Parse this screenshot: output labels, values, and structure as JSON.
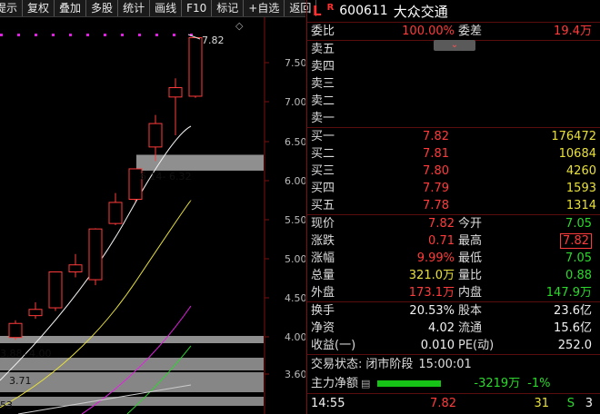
{
  "toolbar": {
    "items": [
      "提示",
      "复权",
      "叠加",
      "多股",
      "统计",
      "画线",
      "F10",
      "标记",
      "+自选",
      "返回"
    ]
  },
  "quote": {
    "lr_marker": "L",
    "r_marker": "R",
    "code": "600611",
    "name": "大众交通",
    "weibi_label": "委比",
    "weibi_value": "100.00%",
    "weicha_label": "委差",
    "weicha_value": "19.4万",
    "sell": [
      {
        "label": "卖五"
      },
      {
        "label": "卖四"
      },
      {
        "label": "卖三"
      },
      {
        "label": "卖二"
      },
      {
        "label": "卖一"
      }
    ],
    "buy": [
      {
        "label": "买一",
        "price": "7.82",
        "volume": "176472"
      },
      {
        "label": "买二",
        "price": "7.81",
        "volume": "10684"
      },
      {
        "label": "买三",
        "price": "7.80",
        "volume": "4260"
      },
      {
        "label": "买四",
        "price": "7.79",
        "volume": "1593"
      },
      {
        "label": "买五",
        "price": "7.78",
        "volume": "1314"
      }
    ],
    "stats": [
      {
        "l1": "现价",
        "v1": "7.82",
        "l2": "今开",
        "v2": "7.05"
      },
      {
        "l1": "涨跌",
        "v1": "0.71",
        "l2": "最高",
        "v2": "7.82"
      },
      {
        "l1": "涨幅",
        "v1": "9.99%",
        "l2": "最低",
        "v2": "7.05"
      },
      {
        "l1": "总量",
        "v1": "321.0万",
        "l2": "量比",
        "v2": "0.88"
      },
      {
        "l1": "外盘",
        "v1": "173.1万",
        "l2": "内盘",
        "v2": "147.9万"
      }
    ],
    "fund": [
      {
        "l1": "换手",
        "v1": "20.53%",
        "l2": "股本",
        "v2": "23.6亿"
      },
      {
        "l1": "净资",
        "v1": "4.02",
        "l2": "流通",
        "v2": "15.6亿"
      },
      {
        "l1": "收益(一)",
        "v1": "0.010",
        "l2": "PE(动)",
        "v2": "252.0"
      }
    ],
    "trade_status_label": "交易状态:",
    "trade_status_value": "闭市阶段",
    "trade_status_time": "15:00:01",
    "main_flow_label": "主力净额",
    "main_flow_value": "-3219万",
    "main_flow_pct": "-1%",
    "tick": {
      "time": "14:55",
      "price": "7.82",
      "volume": "31",
      "side": "S",
      "count": "3"
    }
  },
  "chart_data": {
    "type": "candlestick",
    "y_ticks": [
      "7.50",
      "7.00",
      "6.50",
      "6.00",
      "5.50",
      "5.00",
      "4.50",
      "4.00",
      "3.60"
    ],
    "candles": [
      {
        "o": 3.98,
        "h": 4.2,
        "l": 3.95,
        "c": 4.16
      },
      {
        "o": 4.26,
        "h": 4.43,
        "l": 4.22,
        "c": 4.34
      },
      {
        "o": 4.36,
        "h": 4.82,
        "l": 4.32,
        "c": 4.82
      },
      {
        "o": 4.82,
        "h": 5.05,
        "l": 4.75,
        "c": 4.91
      },
      {
        "o": 4.72,
        "h": 5.38,
        "l": 4.65,
        "c": 5.37
      },
      {
        "o": 5.44,
        "h": 5.83,
        "l": 5.42,
        "c": 5.71
      },
      {
        "o": 5.75,
        "h": 6.14,
        "l": 5.72,
        "c": 6.14
      },
      {
        "o": 6.42,
        "h": 6.83,
        "l": 6.24,
        "c": 6.72
      },
      {
        "o": 7.06,
        "h": 7.3,
        "l": 6.57,
        "c": 7.18
      },
      {
        "o": 7.07,
        "h": 7.82,
        "l": 7.05,
        "c": 7.82
      }
    ],
    "gap_labels": [
      {
        "text": "6.14- 6.32"
      },
      {
        "text": "3.88- 4.00"
      },
      {
        "text": "3.71"
      },
      {
        "text": "53"
      }
    ],
    "max_label": "7.82",
    "diamond": "◇"
  }
}
